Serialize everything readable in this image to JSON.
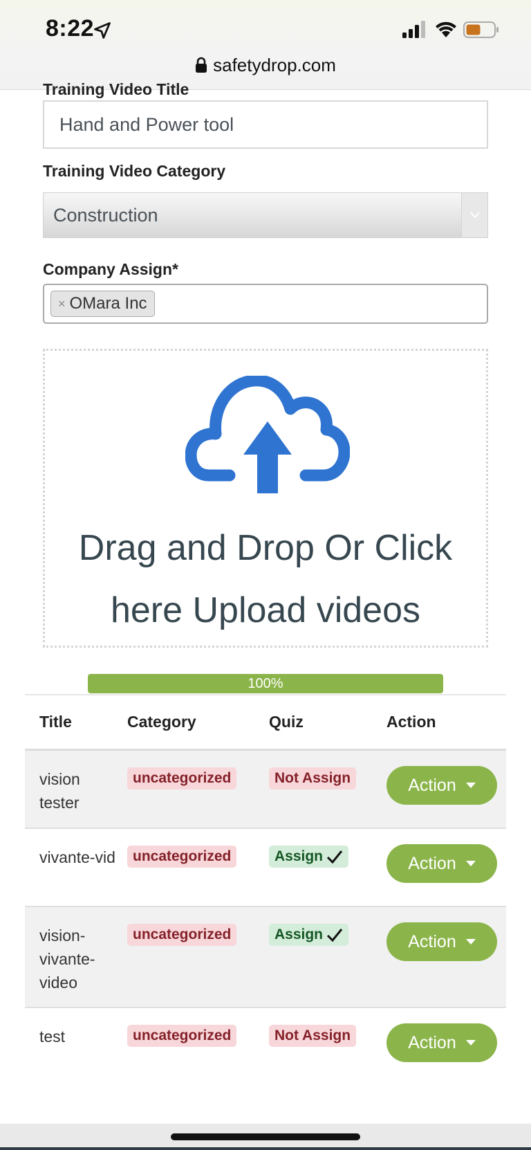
{
  "status_bar": {
    "time": "8:22"
  },
  "browser": {
    "url": "safetydrop.com"
  },
  "form": {
    "clipped_label": "Training Video Title",
    "title_value": "Hand and Power tool",
    "category_label": "Training Video Category",
    "category_value": "Construction",
    "company_label": "Company Assign*",
    "company_chip": "OMara Inc",
    "chip_remove": "×"
  },
  "upload": {
    "line1": "Drag and Drop Or Click",
    "line2": "here Upload videos",
    "progress_label": "100%",
    "progress_value": 1.0
  },
  "table": {
    "headers": {
      "title": "Title",
      "category": "Category",
      "quiz": "Quiz",
      "action": "Action"
    },
    "rows": [
      {
        "title": "vision tester",
        "category": "uncategorized",
        "quiz": "Not Assign",
        "quiz_assigned": false,
        "action": "Action"
      },
      {
        "title": "vivante-vid",
        "category": "uncategorized",
        "quiz": "Assign",
        "quiz_assigned": true,
        "action": "Action"
      },
      {
        "title": "vision-vivante-video",
        "category": "uncategorized",
        "quiz": "Assign",
        "quiz_assigned": true,
        "action": "Action"
      },
      {
        "title": "test",
        "category": "uncategorized",
        "quiz": "Not Assign",
        "quiz_assigned": false,
        "action": "Action"
      }
    ]
  },
  "colors": {
    "accent_green": "#8bb54a",
    "upload_blue": "#2f74d0",
    "danger_bg": "#f8d7da",
    "success_bg": "#d4edda"
  }
}
